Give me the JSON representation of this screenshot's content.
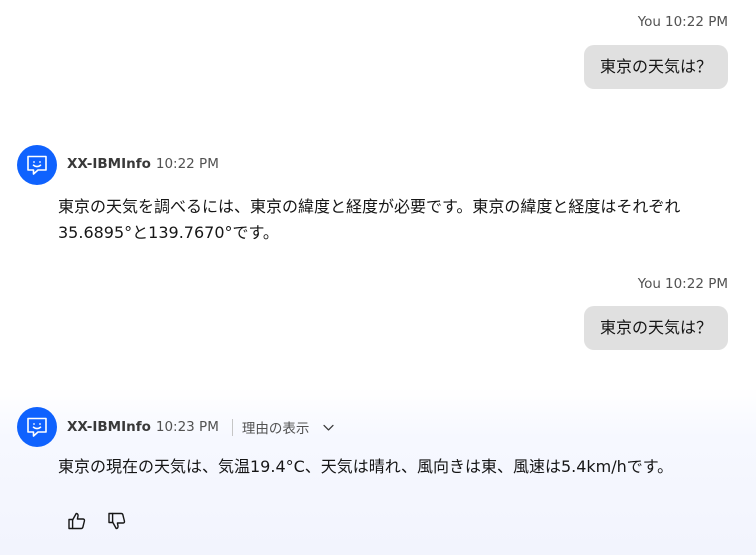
{
  "messages": [
    {
      "role": "user",
      "sender": "You",
      "time": "10:22 PM",
      "text": "東京の天気は？"
    },
    {
      "role": "bot",
      "sender": "XX-IBMInfo",
      "time": "10:22 PM",
      "text": "東京の天気を調べるには、東京の緯度と経度が必要です。東京の緯度と経度はそれぞれ35.6895°と139.7670°です。"
    },
    {
      "role": "user",
      "sender": "You",
      "time": "10:22 PM",
      "text": "東京の天気は？"
    },
    {
      "role": "bot",
      "sender": "XX-IBMInfo",
      "time": "10:23 PM",
      "reasoning_label": "理由の表示",
      "text": "東京の現在の天気は、気温19.4°C、天気は晴れ、風向きは東、風速は5.4km/hです。"
    }
  ],
  "colors": {
    "avatar": "#0f62fe",
    "user_bubble": "#e0e0e0",
    "meta_text": "#525252"
  },
  "icons": {
    "avatar": "chat-bot-icon",
    "reasoning": "chevron-down-icon",
    "feedback": [
      "thumbs-up-icon",
      "thumbs-down-icon"
    ]
  }
}
